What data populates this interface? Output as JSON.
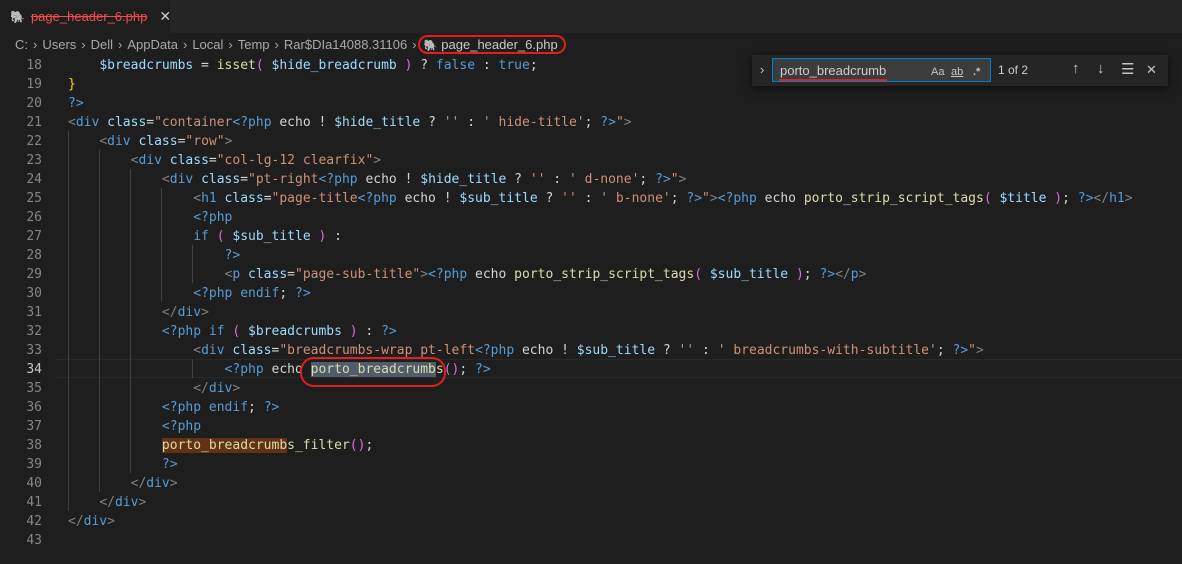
{
  "tab": {
    "icon": "php-elephant-icon",
    "filename": "page_header_6.php",
    "close": "✕"
  },
  "breadcrumbs": [
    "C:",
    "Users",
    "Dell",
    "AppData",
    "Local",
    "Temp",
    "Rar$DIa14088.31106",
    "page_header_6.php"
  ],
  "find_widget": {
    "query": "porto_breadcrumb",
    "match_case": "Aa",
    "whole_word": "ab",
    "regex": ".*",
    "result_count": "1 of 2",
    "prev": "↑",
    "next": "↓",
    "selection": "☰",
    "close": "✕"
  },
  "editor": {
    "active_line": "34",
    "line_numbers": [
      "18",
      "19",
      "20",
      "21",
      "22",
      "23",
      "24",
      "25",
      "26",
      "27",
      "28",
      "29",
      "30",
      "31",
      "32",
      "33",
      "34",
      "35",
      "36",
      "37",
      "38",
      "39",
      "40",
      "41",
      "42",
      "43"
    ]
  },
  "annotation_color": "#e0201a"
}
